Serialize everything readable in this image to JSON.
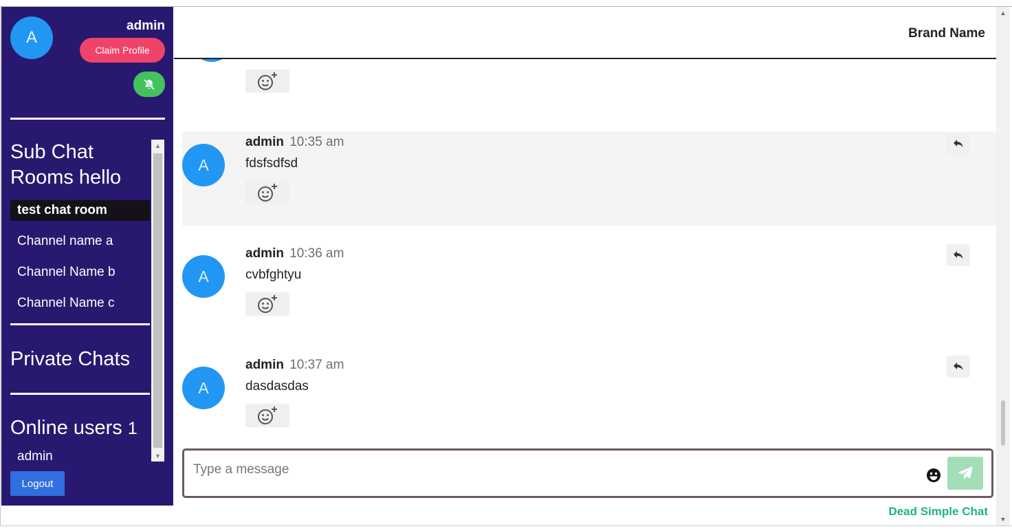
{
  "sidebar": {
    "avatar_letter": "A",
    "username": "admin",
    "claim_profile_label": "Claim Profile",
    "sub_chat_title": "Sub Chat Rooms hello",
    "rooms": [
      {
        "label": "test chat room",
        "active": true
      },
      {
        "label": "Channel name a",
        "active": false
      },
      {
        "label": "Channel Name b",
        "active": false
      },
      {
        "label": "Channel Name c",
        "active": false
      }
    ],
    "private_chats_title": "Private Chats",
    "online_users_title": "Online users",
    "online_users_count": "1",
    "online_users": [
      "admin"
    ],
    "logout_label": "Logout"
  },
  "header": {
    "brand": "Brand Name"
  },
  "messages": [
    {
      "avatar_letter": "A",
      "author": "admin",
      "time": "10:35 am",
      "text": "fdsfsdfsd",
      "highlight": true
    },
    {
      "avatar_letter": "A",
      "author": "admin",
      "time": "10:36 am",
      "text": "cvbfghtyu",
      "highlight": false
    },
    {
      "avatar_letter": "A",
      "author": "admin",
      "time": "10:37 am",
      "text": "dasdasdas",
      "highlight": false
    }
  ],
  "composer": {
    "placeholder": "Type a message"
  },
  "footer": {
    "powered_by": "Dead Simple Chat"
  },
  "colors": {
    "sidebar_bg": "#291870",
    "avatar": "#2296f3",
    "claim_button": "#ef4467",
    "mute_button": "#43c25d",
    "logout_button": "#2f6fe0",
    "send_button": "#a3deb8",
    "powered_by": "#1fb47a"
  },
  "icons": {
    "mute": "bell-slash-icon",
    "react": "add-reaction-icon",
    "reply": "reply-icon",
    "emoji": "emoji-icon",
    "send": "paper-plane-icon"
  }
}
